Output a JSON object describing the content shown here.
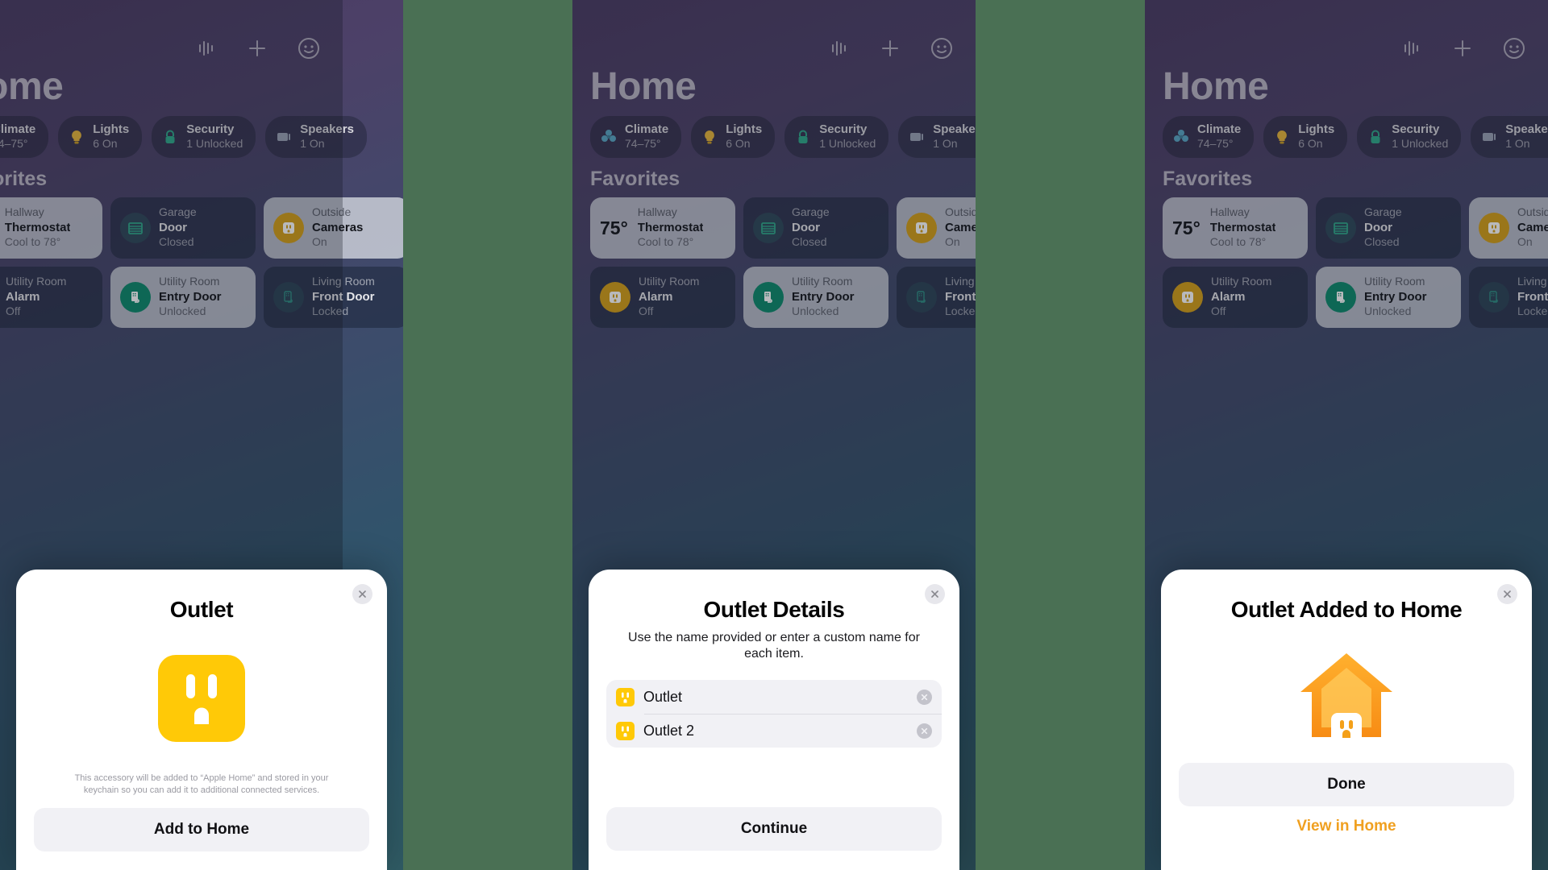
{
  "app": {
    "title": "Home",
    "favorites_header": "Favorites",
    "toolbar": [
      {
        "name": "audio-waveform-icon",
        "label": "Audio"
      },
      {
        "name": "add-icon",
        "label": "Add"
      },
      {
        "name": "more-options-icon",
        "label": "More"
      }
    ]
  },
  "categories": [
    {
      "name": "Climate",
      "status": "74–75°",
      "icon": "fan-icon",
      "color": "#5aa7c4"
    },
    {
      "name": "Lights",
      "status": "6 On",
      "icon": "bulb-icon",
      "color": "#e8b63a"
    },
    {
      "name": "Security",
      "status": "1 Unlocked",
      "icon": "lock-icon",
      "color": "#2fa98a"
    },
    {
      "name": "Speakers",
      "status": "1 On",
      "icon": "speaker-icon",
      "color": "#9aa3b5"
    }
  ],
  "favorites": [
    {
      "room": "Hallway",
      "device": "Thermostat",
      "status": "Cool to 78°",
      "temp": "75°",
      "icon": "thermostat-icon",
      "theme": "light",
      "accent": "#14161c"
    },
    {
      "room": "Garage",
      "device": "Door",
      "status": "Closed",
      "temp": "",
      "icon": "garage-door-icon",
      "theme": "dark",
      "accent": "#2fa98a"
    },
    {
      "room": "Outside",
      "device": "Cameras",
      "status": "On",
      "temp": "",
      "icon": "outlet-icon",
      "theme": "light",
      "accent": "#d4a017"
    },
    {
      "room": "Utility Room",
      "device": "Alarm",
      "status": "Off",
      "temp": "",
      "icon": "outlet-icon",
      "theme": "dark",
      "accent": "#d4a017"
    },
    {
      "room": "Utility Room",
      "device": "Entry Door",
      "status": "Unlocked",
      "temp": "",
      "icon": "door-lock-icon",
      "theme": "light",
      "accent": "#0c8a6c"
    },
    {
      "room": "Living Room",
      "device": "Front Door",
      "status": "Locked",
      "temp": "",
      "icon": "door-lock-icon",
      "theme": "dark",
      "accent": "#1f4a6b"
    }
  ],
  "sheet1": {
    "title": "Outlet",
    "hero_icon": "outlet-icon",
    "disclaimer": "This accessory will be added to “Apple Home” and stored in your keychain so you can add it to additional connected services.",
    "primary_label": "Add to Home",
    "close_label": "Close"
  },
  "sheet2": {
    "title": "Outlet Details",
    "subtitle": "Use the name provided or enter a custom name for each item.",
    "items": [
      {
        "icon": "outlet-icon",
        "value": "Outlet",
        "placeholder": "Name"
      },
      {
        "icon": "outlet-icon",
        "value": "Outlet 2",
        "placeholder": "Name"
      }
    ],
    "clear_label": "Clear",
    "primary_label": "Continue",
    "close_label": "Close"
  },
  "sheet3": {
    "title": "Outlet Added to Home",
    "hero_icon": "house-outlet-icon",
    "primary_label": "Done",
    "link_label": "View in Home",
    "close_label": "Close"
  },
  "colors": {
    "outlet_yellow": "#ffc907",
    "accent_orange": "#f0a020",
    "sheet_bg": "#ffffff",
    "field_bg": "#f1f1f5",
    "filler_green": "#4a7054"
  }
}
